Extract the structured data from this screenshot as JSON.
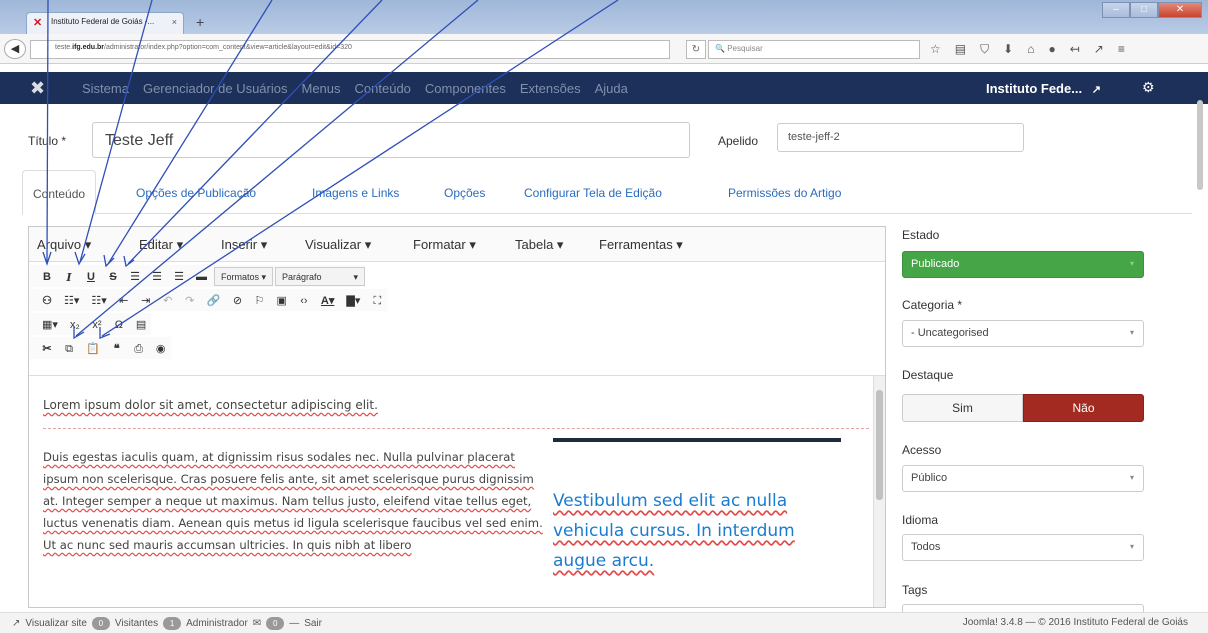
{
  "browser": {
    "tab_title": "Instituto Federal de Goiás -...",
    "tab_close": "×",
    "new_tab": "+",
    "url_prefix": "teste.",
    "url_domain": "ifg.edu.br",
    "url_rest": "/administrator/index.php?option=com_content&view=article&layout=edit&id=320",
    "search_placeholder": "Pesquisar",
    "win_min": "–",
    "win_max": "□",
    "win_close": "✕"
  },
  "joomla_header": {
    "menu": [
      "Sistema",
      "Gerenciador de Usuários",
      "Menus",
      "Conteúdo",
      "Componentes",
      "Extensões",
      "Ajuda"
    ],
    "site_name": "Instituto Fede...",
    "site_link_icon": "↗",
    "gear_icon": "⚙"
  },
  "article": {
    "title_label": "Título *",
    "title_value": "Teste Jeff",
    "alias_label": "Apelido",
    "alias_value": "teste-jeff-2"
  },
  "tabs": [
    "Conteúdo",
    "Opções de Publicação",
    "Imagens e Links",
    "Opções",
    "Configurar Tela de Edição",
    "Permissões do Artigo"
  ],
  "editor": {
    "menus": [
      "Arquivo ▾",
      "Editar ▾",
      "Inserir ▾",
      "Visualizar ▾",
      "Formatar ▾",
      "Tabela ▾",
      "Ferramentas ▾"
    ],
    "formats_label": "Formatos ▾",
    "paragraph_label": "Parágrafo",
    "paragraph_caret": "▾",
    "line1": "Lorem ipsum dolor sit amet, consectetur adipiscing elit.",
    "body_words": [
      "Duis egestas iaculis quam, at dignissim risus sodales nec. Nulla pulvinar placerat ipsum non scelerisque. Cras posuere felis ante, sit amet scelerisque purus dignissim at. Integer semper a neque ut maximus. Nam tellus justo, eleifend vitae tellus eget, luctus venenatis diam. Aenean quis metus id ligula scelerisque faucibus vel sed enim. Ut ac nunc sed mauris accumsan ultricies. In quis nibh at libero"
    ],
    "quote": "Vestibulum sed elit ac nulla vehicula cursus. In interdum augue arcu."
  },
  "sidebar": {
    "status_label": "Estado",
    "status_value": "Publicado",
    "category_label": "Categoria *",
    "category_value": "- Uncategorised",
    "featured_label": "Destaque",
    "featured_yes": "Sim",
    "featured_no": "Não",
    "access_label": "Acesso",
    "access_value": "Público",
    "language_label": "Idioma",
    "language_value": "Todos",
    "tags_label": "Tags",
    "caret": "▾"
  },
  "statusbar": {
    "view_site": "Visualizar site",
    "visitors_count": "0",
    "visitors_label": "Visitantes",
    "admin_count": "1",
    "admin_label": "Administrador",
    "messages_count": "0",
    "logout": "Sair",
    "version": "Joomla! 3.4.8 — © 2016 Instituto Federal de Goiás"
  },
  "colors": {
    "joomla_header": "#1c3059",
    "published_green": "#46a546",
    "no_red": "#a32a21",
    "link_blue": "#2a6cbf",
    "annotation_arrow": "#2f4fb8"
  }
}
